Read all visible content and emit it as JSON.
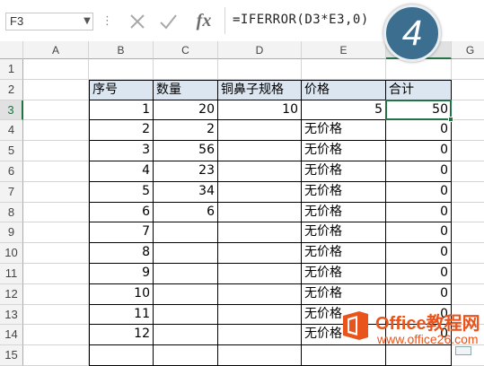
{
  "formula_bar": {
    "name_box": "F3",
    "fx_label": "fx",
    "formula": "=IFERROR(D3*E3,0)"
  },
  "step_badge": "4",
  "columns": [
    "A",
    "B",
    "C",
    "D",
    "E",
    "F",
    "G"
  ],
  "selected_column": "F",
  "rows": [
    "1",
    "2",
    "3",
    "4",
    "5",
    "6",
    "7",
    "8",
    "9",
    "10",
    "11",
    "12",
    "13",
    "14",
    "15"
  ],
  "selected_row": "3",
  "table": {
    "headers": [
      "序号",
      "数量",
      "铜鼻子规格",
      "价格",
      "合计"
    ],
    "rows": [
      [
        "1",
        "20",
        "10",
        "5",
        "50"
      ],
      [
        "2",
        "2",
        "",
        "无价格",
        "0"
      ],
      [
        "3",
        "56",
        "",
        "无价格",
        "0"
      ],
      [
        "4",
        "23",
        "",
        "无价格",
        "0"
      ],
      [
        "5",
        "34",
        "",
        "无价格",
        "0"
      ],
      [
        "6",
        "6",
        "",
        "无价格",
        "0"
      ],
      [
        "7",
        "",
        "",
        "无价格",
        "0"
      ],
      [
        "8",
        "",
        "",
        "无价格",
        "0"
      ],
      [
        "9",
        "",
        "",
        "无价格",
        "0"
      ],
      [
        "10",
        "",
        "",
        "无价格",
        "0"
      ],
      [
        "11",
        "",
        "",
        "无价格",
        "0"
      ],
      [
        "12",
        "",
        "",
        "无价格",
        "0"
      ]
    ]
  },
  "watermark": {
    "title": "Office教程网",
    "url": "www.office26.com"
  },
  "colors": {
    "accent": "#217346",
    "header_fill": "#dce6f1",
    "badge": "#3c6e8f",
    "watermark": "#e8541c"
  }
}
